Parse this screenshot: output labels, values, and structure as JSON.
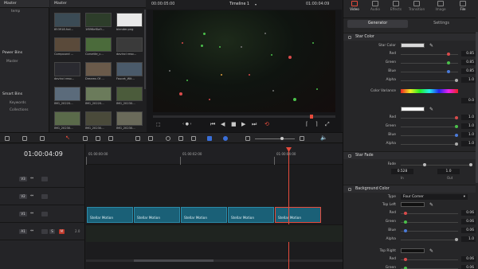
{
  "bins": {
    "master": "Master",
    "temp": "temp",
    "power_bins": "Power Bins",
    "power_master": "Master",
    "smart_bins": "Smart Bins",
    "smart_items": [
      "Keywords",
      "Collections"
    ]
  },
  "pool": {
    "title": "Master",
    "clips": [
      "853918.fxd...",
      "1f896ef0a9...",
      "blender.png",
      "Compound ...",
      "Corvette_c...",
      "davinci reso...",
      "davinci reso...",
      "Dreams Of ...",
      "Faucet_Wit...",
      "IMG_20220...",
      "IMG_20220...",
      "IMG_20230...",
      "IMG_20230...",
      "IMG_20230...",
      "IMG_20230..."
    ]
  },
  "viewer": {
    "timecode_left": "00:00:05:00",
    "timeline_name": "Timeline 1",
    "timecode_right": "01:00:04:09"
  },
  "timeline": {
    "current_tc": "01:00:04:09",
    "ruler": [
      "01:00:00:00",
      "01:00:02:00",
      "01:00:04:00"
    ],
    "tracks": [
      {
        "name": "V3"
      },
      {
        "name": "V2"
      },
      {
        "name": "V1"
      },
      {
        "name": "A1",
        "level": "2.0"
      }
    ],
    "clips": [
      "Stellar Motion",
      "Stellar Motion",
      "Stellar Motion",
      "Stellar Motion",
      "Stellar Motion"
    ]
  },
  "inspector": {
    "tabs": [
      "Video",
      "Audio",
      "Effects",
      "Transition",
      "Image",
      "File"
    ],
    "sub_tabs": [
      "Generator",
      "Settings"
    ],
    "star_color": {
      "title": "Star Color",
      "label": "Star Color",
      "rows": [
        {
          "label": "Red",
          "value": "0.85"
        },
        {
          "label": "Green",
          "value": "0.85"
        },
        {
          "label": "Blue",
          "value": "0.85"
        },
        {
          "label": "Alpha",
          "value": "1.0"
        }
      ]
    },
    "color_variance": {
      "label": "Color Variance",
      "value": "0.0",
      "rows": [
        {
          "label": "Red",
          "value": "1.0"
        },
        {
          "label": "Green",
          "value": "1.0"
        },
        {
          "label": "Blue",
          "value": "1.0"
        },
        {
          "label": "Alpha",
          "value": "1.0"
        }
      ]
    },
    "star_fade": {
      "title": "Star Fade",
      "label": "Fade",
      "in_value": "0.528",
      "out_value": "1.0",
      "in_label": "In",
      "out_label": "Out"
    },
    "background": {
      "title": "Background Color",
      "type_label": "Type",
      "type_value": "Four Corner",
      "top_left": "Top Left",
      "tl_rows": [
        {
          "label": "Red",
          "value": "0.06"
        },
        {
          "label": "Green",
          "value": "0.06"
        },
        {
          "label": "Blue",
          "value": "0.06"
        },
        {
          "label": "Alpha",
          "value": "1.0"
        }
      ],
      "top_right": "Top Right",
      "tr_rows": [
        {
          "label": "Red",
          "value": "0.06"
        },
        {
          "label": "Green",
          "value": "0.06"
        }
      ]
    }
  },
  "colors": {
    "accent": "#e64b3c",
    "clip": "#1a6077",
    "red_knob": "#d94b4b",
    "green_knob": "#4bc14b",
    "blue_knob": "#4b7bd9"
  }
}
